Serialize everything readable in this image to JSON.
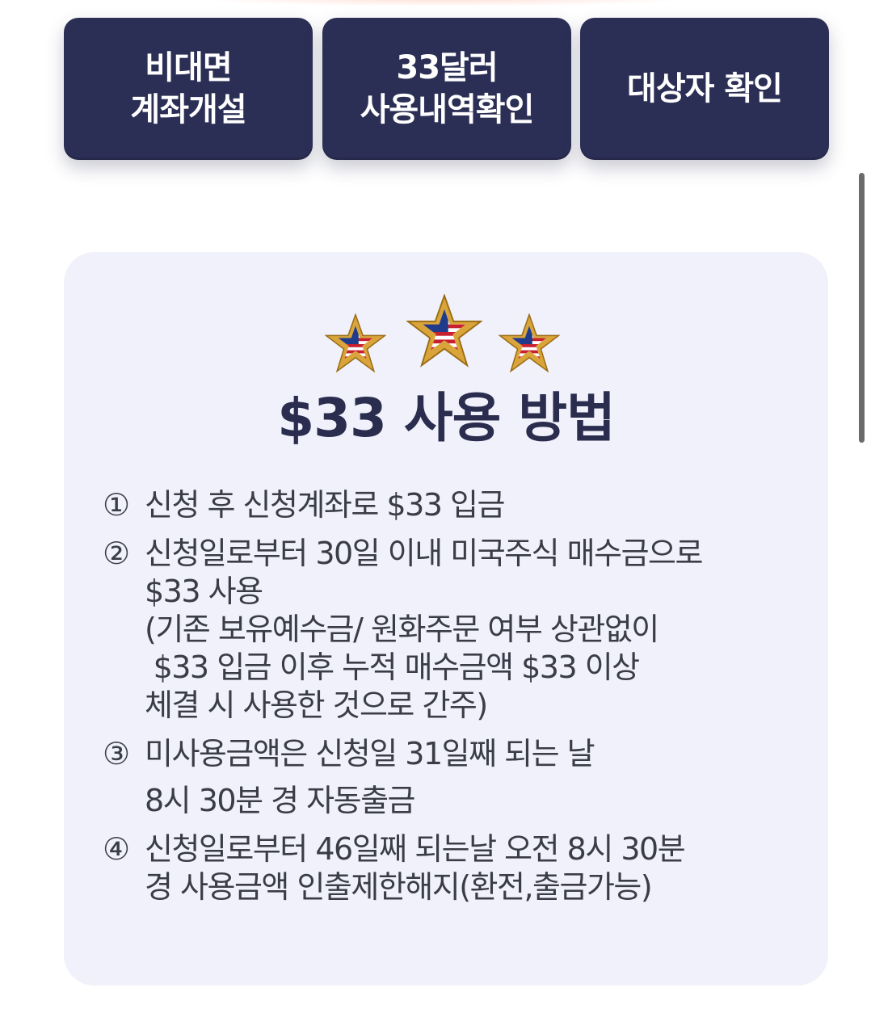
{
  "buttons": [
    {
      "line1": "비대면",
      "line2": "계좌개설"
    },
    {
      "line1": "33달러",
      "line2": "사용내역확인"
    },
    {
      "line1": "대상자 확인"
    }
  ],
  "card": {
    "title": "$33 사용 방법",
    "steps": [
      {
        "num": "①",
        "lines": [
          "신청 후 신청계좌로 $33 입금"
        ]
      },
      {
        "num": "②",
        "lines": [
          "신청일로부터 30일 이내 미국주식 매수금으로",
          "$33 사용",
          "(기존 보유예수금/ 원화주문 여부 상관없이",
          " $33 입금 이후 누적 매수금액 $33 이상",
          "체결 시 사용한 것으로 간주)"
        ]
      },
      {
        "num": "③",
        "lines": [
          "미사용금액은 신청일 31일째 되는 날",
          "8시 30분 경 자동출금"
        ]
      },
      {
        "num": "④",
        "lines": [
          "신청일로부터 46일째 되는날 오전 8시 30분",
          "경 사용금액 인출제한해지(환전,출금가능)"
        ]
      }
    ]
  },
  "icons": {
    "star": "us-flag-star-icon"
  },
  "colors": {
    "button_bg": "#2c2f55",
    "card_bg": "#f0f1fa",
    "title": "#2b2d4f",
    "text": "#3a3c48",
    "star_gold": "#d9a53a"
  }
}
